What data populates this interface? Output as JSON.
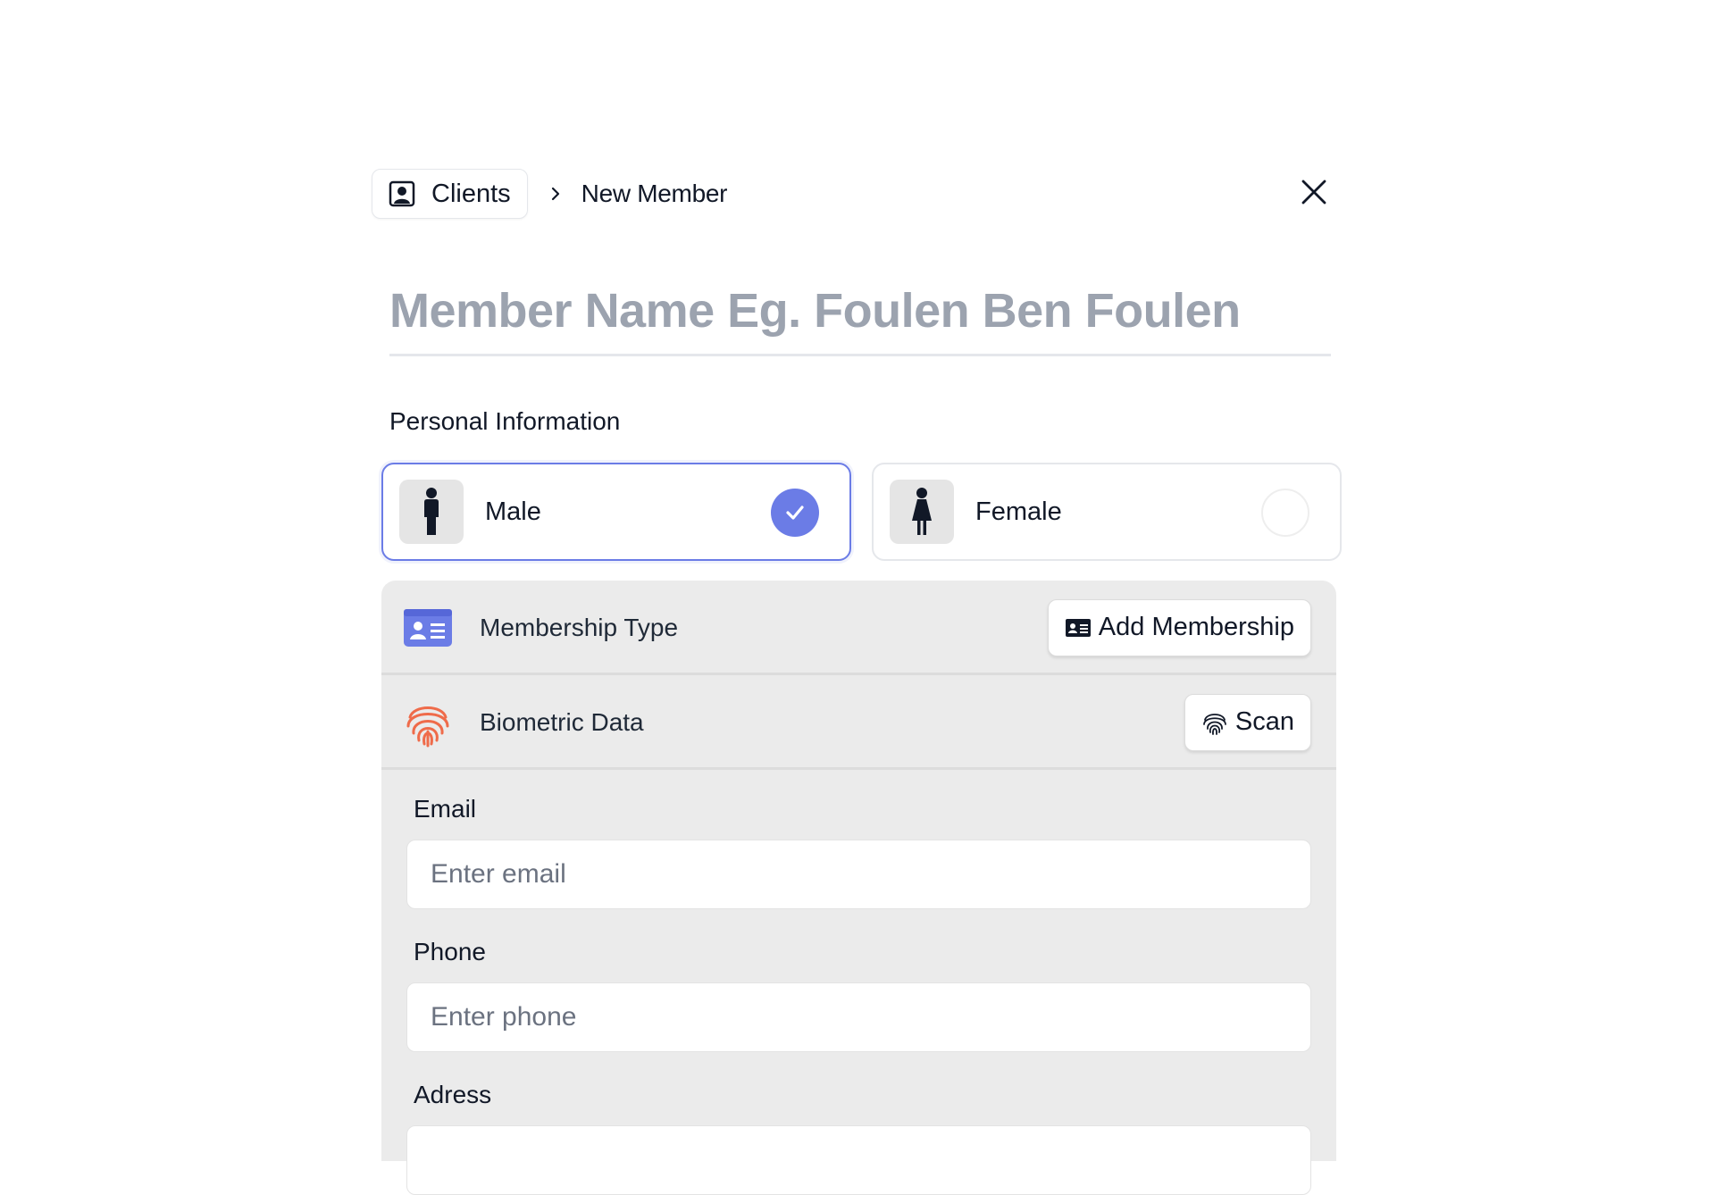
{
  "breadcrumb": {
    "root_label": "Clients",
    "root_icon": "contact-card-icon",
    "separator_icon": "chevron-right-icon",
    "current_label": "New Member"
  },
  "close_icon": "close-icon",
  "member_name": {
    "value": "",
    "placeholder": "Member Name Eg. Foulen Ben Foulen"
  },
  "personal_info": {
    "title": "Personal Information",
    "genders": [
      {
        "label": "Male",
        "icon": "male-person-icon",
        "selected": true
      },
      {
        "label": "Female",
        "icon": "female-person-icon",
        "selected": false
      }
    ]
  },
  "membership": {
    "label": "Membership Type",
    "icon": "id-card-icon",
    "button_label": "Add Membership",
    "button_icon": "id-card-icon"
  },
  "biometric": {
    "label": "Biometric Data",
    "icon": "fingerprint-icon",
    "button_label": "Scan",
    "button_icon": "fingerprint-icon"
  },
  "fields": {
    "email": {
      "label": "Email",
      "value": "",
      "placeholder": "Enter email"
    },
    "phone": {
      "label": "Phone",
      "value": "",
      "placeholder": "Enter phone"
    },
    "address": {
      "label": "Adress",
      "value": "",
      "placeholder": ""
    }
  },
  "colors": {
    "accent": "#6b7ce6",
    "membership_icon": "#6b7ce6",
    "fingerprint_icon": "#ef6b4a",
    "panel_bg": "#ebebeb",
    "placeholder": "#9ca3af"
  }
}
